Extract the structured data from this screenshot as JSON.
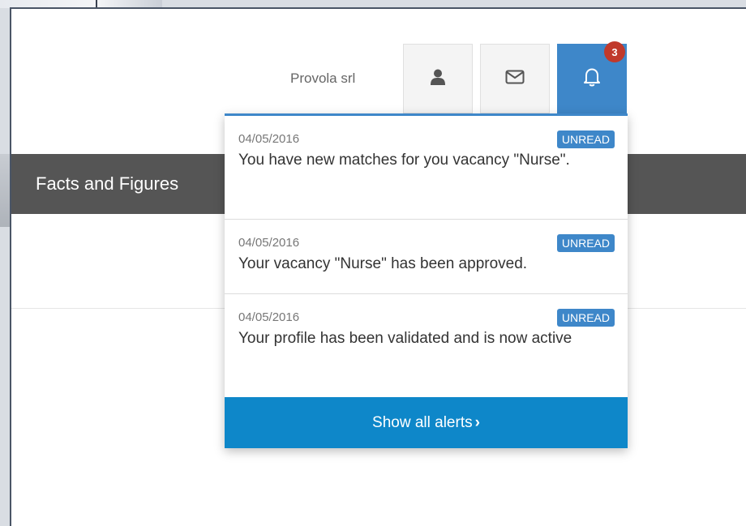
{
  "header": {
    "user_name": "Provola srl",
    "notification_count": "3"
  },
  "nav": {
    "title": "Facts and Figures"
  },
  "alerts": [
    {
      "date": "04/05/2016",
      "status": "UNREAD",
      "text": "You have new matches for you vacancy \"Nurse\"."
    },
    {
      "date": "04/05/2016",
      "status": "UNREAD",
      "text": "Your vacancy \"Nurse\" has been approved."
    },
    {
      "date": "04/05/2016",
      "status": "UNREAD",
      "text": "Your profile has been validated and is now active"
    }
  ],
  "footer": {
    "show_all_label": "Show all alerts",
    "chevron": "›"
  },
  "icons": {
    "user": "user-icon",
    "mail": "envelope-icon",
    "bell": "bell-icon"
  },
  "colors": {
    "accent": "#3e87c9",
    "badge": "#c0392b",
    "nav_bar": "#555555",
    "show_all": "#0e87c9"
  }
}
